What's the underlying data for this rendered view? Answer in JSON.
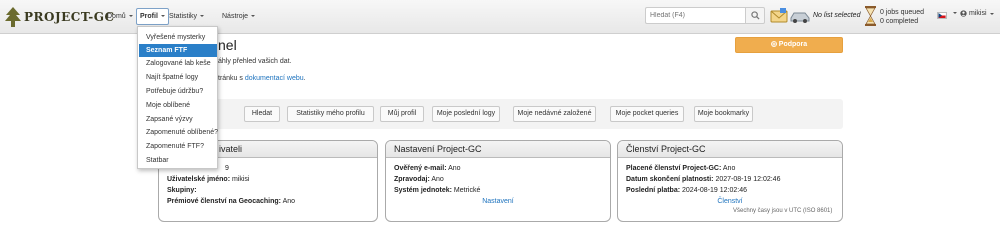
{
  "navbar": {
    "brand": "PROJECT-GC",
    "menu": [
      "Domů",
      "Profil",
      "Statistiky",
      "Nástroje"
    ],
    "search": {
      "placeholder": "Hledat (F4)"
    },
    "list_selected": "No list selected",
    "jobs": {
      "queued": "0 jobs queued",
      "completed": "0 completed"
    },
    "user": "mikisi"
  },
  "profile_menu": {
    "items": [
      "Vyřešené mysterky",
      "Seznam FTF",
      "Zalogované lab keše",
      "Najít špatné logy",
      "Potřebuje údržbu?",
      "Moje oblíbené",
      "Zapsané výzvy",
      "Zapomenuté oblíbené?",
      "Zapomenuté FTF?",
      "Statbar"
    ],
    "active_index": 1
  },
  "page": {
    "title_visible": "nel",
    "intro1": "áhly přehled vašich dat.",
    "intro2_prefix": "tránku s ",
    "intro2_link": "dokumentací webu",
    "intro2_suffix": ".",
    "support_button": "Podpora"
  },
  "toolbar": [
    "Hledat",
    "Statistiky mého profilu",
    "Můj profil",
    "Moje poslední logy",
    "Moje nedávné založené",
    "Moje pocket queries",
    "Moje bookmarky"
  ],
  "panels": {
    "user": {
      "title_visible": "ivateli",
      "row1_visible": "9",
      "username_label": "Uživatelské jméno:",
      "username_value": "mikisi",
      "groups_label": "Skupiny:",
      "premium_label": "Prémiové členství na Geocaching:",
      "premium_value": "Ano"
    },
    "settings": {
      "title": "Nastavení Project-GC",
      "email_label": "Ověřený e-mail:",
      "email_value": "Ano",
      "news_label": "Zpravodaj:",
      "news_value": "Ano",
      "units_label": "Systém jednotek:",
      "units_value": "Metrické",
      "link": "Nastavení"
    },
    "membership": {
      "title": "Členství Project-GC",
      "paid_label": "Placené členství Project-GC:",
      "paid_value": "Ano",
      "expiry_label": "Datum skončení platnosti:",
      "expiry_value": "2027-08-19 12:02:46",
      "last_label": "Poslední platba:",
      "last_value": "2024-08-19 12:02:46",
      "link": "Členství"
    }
  },
  "timezone_note": "Všechny časy jsou v UTC (ISO 8601)",
  "colors": {
    "accent": "#2a7fc8",
    "support": "#f0ad4e",
    "link": "#1e73be"
  }
}
